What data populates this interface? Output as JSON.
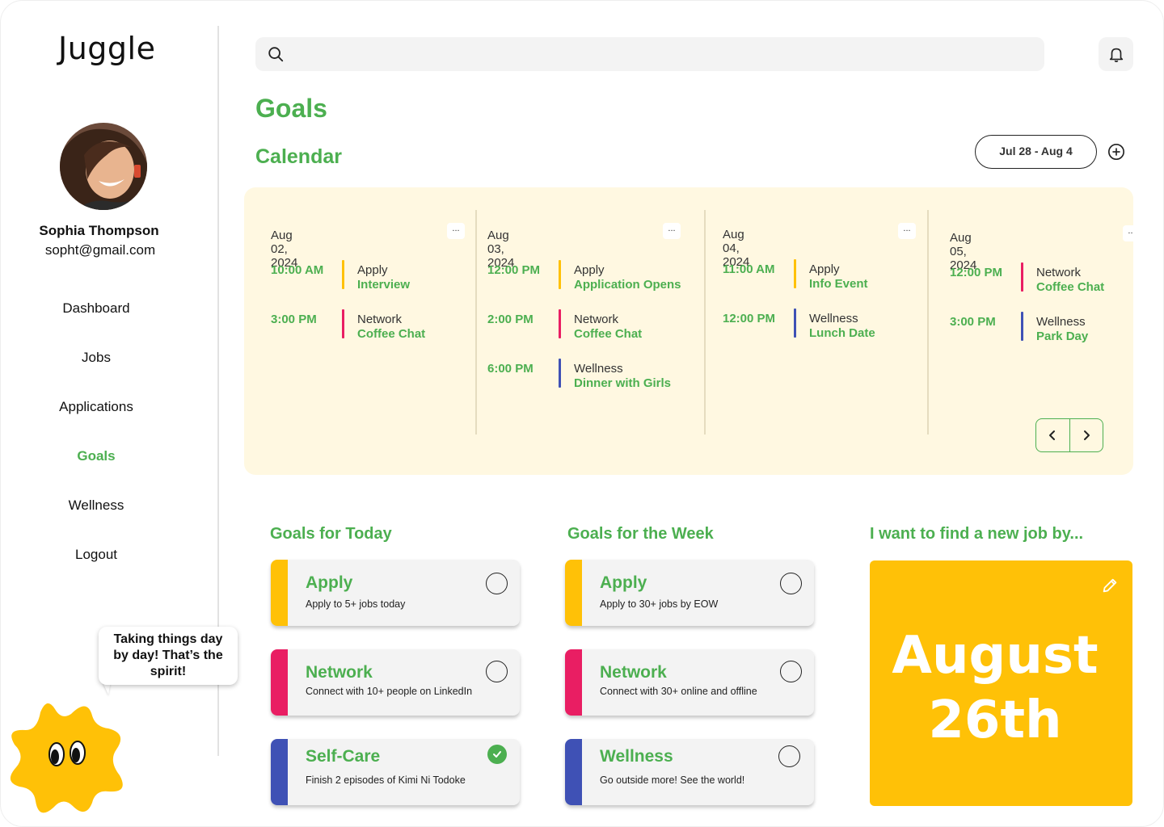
{
  "app": {
    "logo": "Juggle"
  },
  "user": {
    "name": "Sophia Thompson",
    "email": "sopht@gmail.com"
  },
  "nav": {
    "items": [
      {
        "label": "Dashboard",
        "active": false
      },
      {
        "label": "Jobs",
        "active": false
      },
      {
        "label": "Applications",
        "active": false
      },
      {
        "label": "Goals",
        "active": true
      },
      {
        "label": "Wellness",
        "active": false
      },
      {
        "label": "Logout",
        "active": false
      }
    ]
  },
  "mascot": {
    "bubble": "Taking things day by day! That’s the spirit!"
  },
  "search": {
    "placeholder": ""
  },
  "header": {
    "title": "Goals",
    "calendar_title": "Calendar",
    "date_range": "Jul 28 - Aug 4"
  },
  "calendar": {
    "days": [
      {
        "date": "Aug 02, 2024",
        "events": [
          {
            "time": "10:00 AM",
            "category": "Apply",
            "title": "Interview",
            "color": "#ffc107"
          },
          {
            "time": "3:00 PM",
            "category": "Network",
            "title": "Coffee Chat",
            "color": "#e91e63"
          }
        ]
      },
      {
        "date": "Aug 03, 2024",
        "events": [
          {
            "time": "12:00 PM",
            "category": "Apply",
            "title": "Application Opens",
            "color": "#ffc107"
          },
          {
            "time": "2:00 PM",
            "category": "Network",
            "title": "Coffee Chat",
            "color": "#e91e63"
          },
          {
            "time": "6:00 PM",
            "category": "Wellness",
            "title": "Dinner with Girls",
            "color": "#3f51b5"
          }
        ]
      },
      {
        "date": "Aug 04, 2024",
        "events": [
          {
            "time": "11:00 AM",
            "category": "Apply",
            "title": "Info Event",
            "color": "#ffc107"
          },
          {
            "time": "12:00 PM",
            "category": "Wellness",
            "title": "Lunch Date",
            "color": "#3f51b5"
          }
        ]
      },
      {
        "date": "Aug 05, 2024",
        "events": [
          {
            "time": "12:00 PM",
            "category": "Network",
            "title": "Coffee Chat",
            "color": "#e91e63"
          },
          {
            "time": "3:00 PM",
            "category": "Wellness",
            "title": "Park Day",
            "color": "#3f51b5"
          }
        ]
      }
    ],
    "more_label": "..."
  },
  "goals_today": {
    "heading": "Goals for Today",
    "items": [
      {
        "title": "Apply",
        "desc": "Apply to 5+ jobs today",
        "color": "#ffc107",
        "done": false
      },
      {
        "title": "Network",
        "desc": "Connect with 10+ people on LinkedIn",
        "color": "#e91e63",
        "done": false
      },
      {
        "title": "Self-Care",
        "desc": "Finish 2 episodes of Kimi Ni Todoke",
        "color": "#3f51b5",
        "done": true
      }
    ]
  },
  "goals_week": {
    "heading": "Goals for the Week",
    "items": [
      {
        "title": "Apply",
        "desc": "Apply to 30+ jobs by EOW",
        "color": "#ffc107",
        "done": false
      },
      {
        "title": "Network",
        "desc": "Connect with 30+ online and offline",
        "color": "#e91e63",
        "done": false
      },
      {
        "title": "Wellness",
        "desc": "Go outside more! See the world!",
        "color": "#3f51b5",
        "done": false
      }
    ]
  },
  "target": {
    "heading": "I want to find a new job by...",
    "line1": "August",
    "line2": "26th"
  },
  "colors": {
    "accent": "#4caf50",
    "apply": "#ffc107",
    "network": "#e91e63",
    "wellness": "#3f51b5",
    "calendar_bg": "#fff8e1"
  }
}
